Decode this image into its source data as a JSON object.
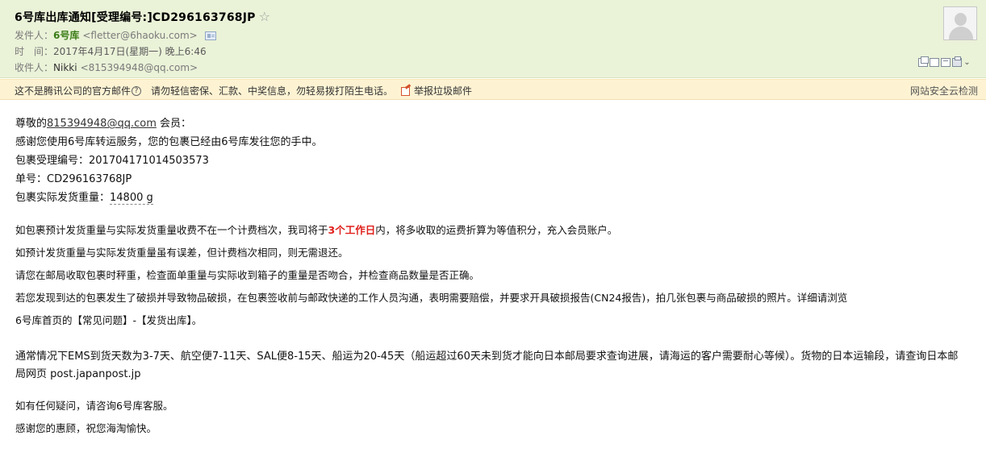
{
  "header": {
    "subject": "6号库出库通知[受理编号:]CD296163768JP",
    "sender_label": "发件人：",
    "sender_name": "6号库",
    "sender_email": "<fletter@6haoku.com>",
    "time_label": "时　间：",
    "time_value": "2017年4月17日(星期一) 晚上6:46",
    "recipient_label": "收件人：",
    "recipient_name": "Nikki",
    "recipient_email": "<815394948@qq.com>"
  },
  "warning_bar": {
    "notice": "这不是腾讯公司的官方邮件",
    "tip": "请勿轻信密保、汇款、中奖信息，勿轻易拨打陌生电话。",
    "report": "举报垃圾邮件",
    "security_check": "网站安全云检测"
  },
  "body": {
    "greeting_prefix": "尊敬的",
    "greeting_email": "815394948@qq.com",
    "greeting_suffix": " 会员：",
    "line_thanks": "感谢您使用6号库转运服务，您的包裹已经由6号库发往您的手中。",
    "line_accept_no": "包裹受理编号：201704171014503573",
    "line_tracking": "单号：CD296163768JP",
    "line_weight_prefix": "包裹实际发货重量：",
    "line_weight_value": "14800 g",
    "para1_prefix": "如包裹预计发货重量与实际发货重量收费不在一个计费档次，我司将于",
    "para1_highlight": "3个工作日",
    "para1_suffix": "内，将多收取的运费折算为等值积分，充入会员账户。",
    "para2": "如预计发货重量与实际发货重量虽有误差，但计费档次相同，则无需退还。",
    "para3": "请您在邮局收取包裹时秤重，检查面单重量与实际收到箱子的重量是否吻合，并检查商品数量是否正确。",
    "para4": "若您发现到达的包裹发生了破损并导致物品破损，在包裹签收前与邮政快递的工作人员沟通，表明需要赔偿，并要求开具破损报告(CN24报告)，拍几张包裹与商品破损的照片。详细请浏览",
    "para4b": "6号库首页的【常见问题】-【发货出库】。",
    "para5": "通常情况下EMS到货天数为3-7天、航空便7-11天、SAL便8-15天、船运为20-45天（船运超过60天未到货才能向日本邮局要求查询进展，请海运的客户需要耐心等候）。货物的日本运输段，请查询日本邮局网页 post.japanpost.jp",
    "para6": "如有任何疑问，请咨询6号库客服。",
    "para7": "感谢您的惠顾，祝您海淘愉快。"
  }
}
